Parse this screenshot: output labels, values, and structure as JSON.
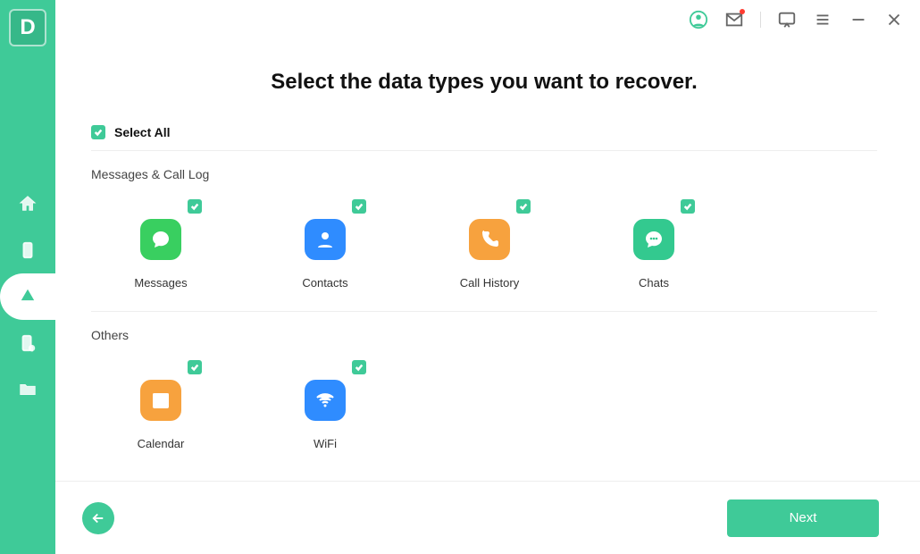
{
  "app_logo_letter": "D",
  "title": "Select the data types you want to recover.",
  "select_all_label": "Select All",
  "sections": {
    "messages": {
      "title": "Messages & Call Log",
      "items": [
        {
          "id": "messages",
          "label": "Messages",
          "color": "green",
          "icon": "speech-bubble"
        },
        {
          "id": "contacts",
          "label": "Contacts",
          "color": "blue",
          "icon": "person"
        },
        {
          "id": "call-history",
          "label": "Call History",
          "color": "orange",
          "icon": "phone"
        },
        {
          "id": "chats",
          "label": "Chats",
          "color": "teal",
          "icon": "chat-dots"
        }
      ]
    },
    "others": {
      "title": "Others",
      "items": [
        {
          "id": "calendar",
          "label": "Calendar",
          "color": "orange",
          "icon": "calendar"
        },
        {
          "id": "wifi",
          "label": "WiFi",
          "color": "blue",
          "icon": "wifi"
        }
      ]
    }
  },
  "footer": {
    "next_label": "Next"
  },
  "topbar_icons": [
    "account",
    "mail",
    "feedback",
    "menu",
    "minimize",
    "close"
  ]
}
